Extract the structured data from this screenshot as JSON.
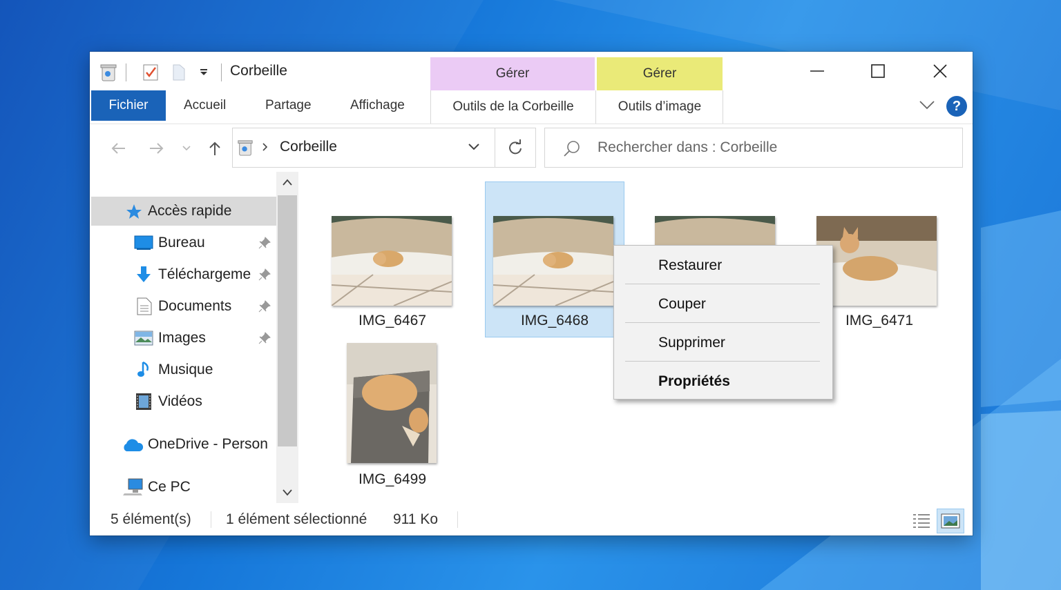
{
  "window": {
    "title": "Corbeille",
    "context_tab_header_recycle": "Gérer",
    "context_tab_header_image": "Gérer"
  },
  "ribbon": {
    "tabs": [
      "Fichier",
      "Accueil",
      "Partage",
      "Affichage"
    ],
    "context_tabs": [
      "Outils de la Corbeille",
      "Outils d’image"
    ]
  },
  "address": {
    "location": "Corbeille",
    "search_placeholder": "Rechercher dans : Corbeille"
  },
  "nav": {
    "quick_access": "Accès rapide",
    "items": [
      "Bureau",
      "Téléchargeme",
      "Documents",
      "Images",
      "Musique",
      "Vidéos"
    ],
    "onedrive": "OneDrive - Person",
    "this_pc": "Ce PC"
  },
  "files": [
    {
      "name": "IMG_6467"
    },
    {
      "name": "IMG_6468"
    },
    {
      "name": "IMG_6471"
    },
    {
      "name": "IMG_6499"
    }
  ],
  "context_menu": {
    "items": [
      "Restaurer",
      "Couper",
      "Supprimer",
      "Propriétés"
    ]
  },
  "status": {
    "count": "5 élément(s)",
    "selected": "1 élément sélectionné",
    "size": "911 Ko"
  },
  "colors": {
    "file_tab": "#1a63b8",
    "recycle_tools": "#ebcbf5",
    "image_tools": "#eaea78",
    "selection": "#cce4f7"
  }
}
